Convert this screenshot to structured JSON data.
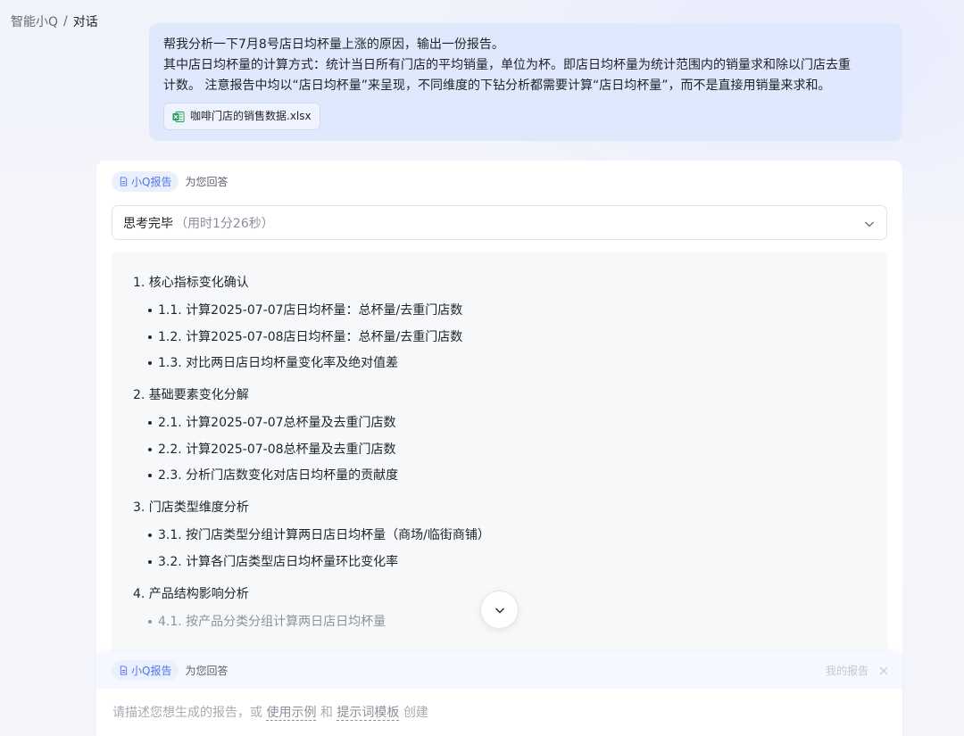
{
  "breadcrumb": {
    "root": "智能小Q",
    "separator": "/",
    "current": "对话"
  },
  "user_message": {
    "lines": [
      "帮我分析一下7月8号店日均杯量上涨的原因，输出一份报告。",
      "其中店日均杯量的计算方式：统计当日所有门店的平均销量，单位为杯。即店日均杯量为统计范围内的销量求和除以门店去重",
      "计数。 注意报告中均以“店日均杯量”来呈现，不同维度的下钻分析都需要计算“店日均杯量”，而不是直接用销量来求和。"
    ],
    "attachment": {
      "name": "咖啡门店的销售数据.xlsx",
      "icon": "xlsx-file-icon"
    }
  },
  "answer": {
    "source_tag": "小Q报告",
    "source_text": "为您回答",
    "thinking": {
      "title": "思考完毕",
      "time": "（用时1分26秒）"
    },
    "plan": [
      {
        "title": "1. 核心指标变化确认",
        "items": [
          "1.1. 计算2025-07-07店日均杯量：总杯量/去重门店数",
          "1.2. 计算2025-07-08店日均杯量：总杯量/去重门店数",
          "1.3. 对比两日店日均杯量变化率及绝对值差"
        ]
      },
      {
        "title": "2. 基础要素变化分解",
        "items": [
          "2.1. 计算2025-07-07总杯量及去重门店数",
          "2.2. 计算2025-07-08总杯量及去重门店数",
          "2.3. 分析门店数变化对店日均杯量的贡献度"
        ]
      },
      {
        "title": "3. 门店类型维度分析",
        "items": [
          "3.1. 按门店类型分组计算两日店日均杯量（商场/临街商铺）",
          "3.2. 计算各门店类型店日均杯量环比变化率"
        ]
      },
      {
        "title": "4. 产品结构影响分析",
        "items": [
          "4.1. 按产品分类分组计算两日店日均杯量"
        ]
      }
    ]
  },
  "composer": {
    "source_tag": "小Q报告",
    "source_text": "为您回答",
    "my_reports": "我的报告",
    "placeholder_prefix": "请描述您想生成的报告，或",
    "link_example": "使用示例",
    "connector": "和",
    "link_template": "提示词模板",
    "placeholder_suffix": "创建"
  },
  "colors": {
    "accent": "#4f75e8",
    "user_bubble": "#dfe8fc",
    "excel_green": "#1f9d55"
  }
}
